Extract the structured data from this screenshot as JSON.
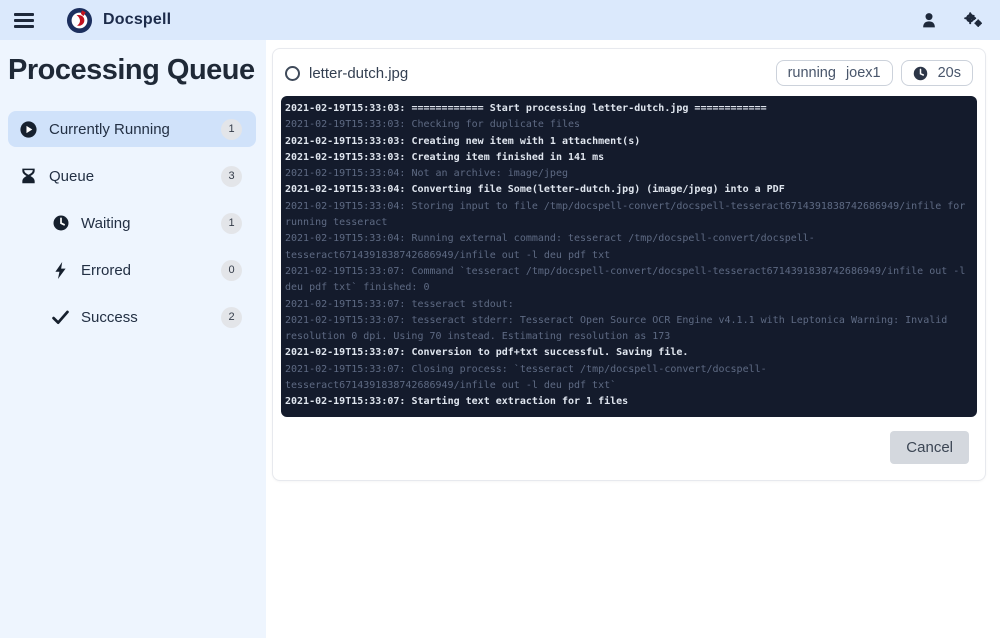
{
  "navbar": {
    "brand": "Docspell"
  },
  "sidebar": {
    "title": "Processing Queue",
    "items": [
      {
        "label": "Currently Running",
        "count": "1",
        "icon": "play-circle-icon",
        "active": true,
        "indent": false
      },
      {
        "label": "Queue",
        "count": "3",
        "icon": "hourglass-icon",
        "active": false,
        "indent": false
      },
      {
        "label": "Waiting",
        "count": "1",
        "icon": "clock-icon",
        "active": false,
        "indent": true
      },
      {
        "label": "Errored",
        "count": "0",
        "icon": "bolt-icon",
        "active": false,
        "indent": true
      },
      {
        "label": "Success",
        "count": "2",
        "icon": "check-icon",
        "active": false,
        "indent": true
      }
    ]
  },
  "job": {
    "filename": "letter-dutch.jpg",
    "state": "running",
    "worker": "joex1",
    "duration": "20s",
    "cancel_label": "Cancel",
    "log": [
      {
        "t": "2021-02-19T15:33:03:",
        "msg": "============ Start processing letter-dutch.jpg ============",
        "level": "info"
      },
      {
        "t": "2021-02-19T15:33:03:",
        "msg": "Checking for duplicate files",
        "level": "debug"
      },
      {
        "t": "2021-02-19T15:33:03:",
        "msg": "Creating new item with 1 attachment(s)",
        "level": "info"
      },
      {
        "t": "2021-02-19T15:33:03:",
        "msg": "Creating item finished in 141 ms",
        "level": "info"
      },
      {
        "t": "2021-02-19T15:33:04:",
        "msg": "Not an archive: image/jpeg",
        "level": "debug"
      },
      {
        "t": "2021-02-19T15:33:04:",
        "msg": "Converting file Some(letter-dutch.jpg) (image/jpeg) into a PDF",
        "level": "info"
      },
      {
        "t": "2021-02-19T15:33:04:",
        "msg": "Storing input to file /tmp/docspell-convert/docspell-tesseract6714391838742686949/infile for running tesseract",
        "level": "debug"
      },
      {
        "t": "2021-02-19T15:33:04:",
        "msg": "Running external command: tesseract /tmp/docspell-convert/docspell-tesseract6714391838742686949/infile out -l deu pdf txt",
        "level": "debug"
      },
      {
        "t": "2021-02-19T15:33:07:",
        "msg": "Command `tesseract /tmp/docspell-convert/docspell-tesseract6714391838742686949/infile out -l deu pdf txt` finished: 0",
        "level": "debug"
      },
      {
        "t": "2021-02-19T15:33:07:",
        "msg": "tesseract stdout:",
        "level": "debug"
      },
      {
        "t": "2021-02-19T15:33:07:",
        "msg": "tesseract stderr: Tesseract Open Source OCR Engine v4.1.1 with Leptonica Warning: Invalid resolution 0 dpi. Using 70 instead. Estimating resolution as 173",
        "level": "debug"
      },
      {
        "t": "2021-02-19T15:33:07:",
        "msg": "Conversion to pdf+txt successful. Saving file.",
        "level": "info"
      },
      {
        "t": "2021-02-19T15:33:07:",
        "msg": "Closing process: `tesseract /tmp/docspell-convert/docspell-tesseract6714391838742686949/infile out -l deu pdf txt`",
        "level": "debug"
      },
      {
        "t": "2021-02-19T15:33:07:",
        "msg": "Starting text extraction for 1 files",
        "level": "info"
      }
    ]
  }
}
